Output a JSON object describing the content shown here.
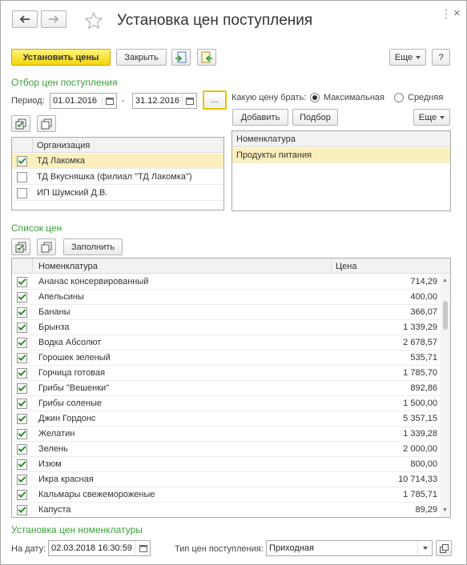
{
  "window": {
    "title": "Установка цен поступления",
    "more_label": "Еще",
    "help_label": "?",
    "close_glyph": "×",
    "menu_glyph": "⋮"
  },
  "toolbar": {
    "set_prices_label": "Установить цены",
    "close_label": "Закрыть"
  },
  "filter": {
    "section_title": "Отбор цен поступления",
    "period_label": "Период:",
    "date_from": "01.01.2016",
    "dash": "-",
    "date_to": "31.12.2016",
    "period_choose_label": "...",
    "price_kind_label": "Какую цену брать:",
    "option_max": "Максимальная",
    "option_avg": "Средняя",
    "selected_option": "max",
    "add_label": "Добавить",
    "pick_label": "Подбор",
    "more_label": "Еще"
  },
  "org_table": {
    "header": "Организация",
    "rows": [
      {
        "name": "ТД Лакомка",
        "checked": true,
        "selected": true
      },
      {
        "name": "ТД Вкусняшка (филиал \"ТД Лакомка\")",
        "checked": false,
        "selected": false
      },
      {
        "name": "ИП Шумский Д.В.",
        "checked": false,
        "selected": false
      }
    ]
  },
  "nom_table": {
    "header": "Номенклатура",
    "rows": [
      {
        "name": "Продукты питания",
        "selected": true
      }
    ]
  },
  "prices": {
    "section_title": "Список цен",
    "fill_label": "Заполнить",
    "col_nomenclature": "Номенклатура",
    "col_price": "Цена",
    "rows": [
      {
        "name": "Ананас консервированный",
        "price": "714,29",
        "checked": true
      },
      {
        "name": "Апельсины",
        "price": "400,00",
        "checked": true
      },
      {
        "name": "Бананы",
        "price": "366,07",
        "checked": true
      },
      {
        "name": "Брынза",
        "price": "1 339,29",
        "checked": true
      },
      {
        "name": "Водка Абсолют",
        "price": "2 678,57",
        "checked": true
      },
      {
        "name": "Горошек зеленый",
        "price": "535,71",
        "checked": true
      },
      {
        "name": "Горчица готовая",
        "price": "1 785,70",
        "checked": true
      },
      {
        "name": "Грибы \"Вешенки\"",
        "price": "892,86",
        "checked": true
      },
      {
        "name": "Грибы соленые",
        "price": "1 500,00",
        "checked": true
      },
      {
        "name": "Джин Гордонс",
        "price": "5 357,15",
        "checked": true
      },
      {
        "name": "Желатин",
        "price": "1 339,28",
        "checked": true
      },
      {
        "name": "Зелень",
        "price": "2 000,00",
        "checked": true
      },
      {
        "name": "Изюм",
        "price": "800,00",
        "checked": true
      },
      {
        "name": "Икра красная",
        "price": "10 714,33",
        "checked": true
      },
      {
        "name": "Кальмары свежемороженые",
        "price": "1 785,71",
        "checked": true
      },
      {
        "name": "Капуста",
        "price": "89,29",
        "checked": true
      }
    ]
  },
  "settings": {
    "section_title": "Установка цен номенклатуры",
    "date_label": "На дату:",
    "date_value": "02.03.2018 16:30:59",
    "price_type_label": "Тип цен поступления:",
    "price_type_value": "Приходная"
  },
  "colors": {
    "accent_green": "#3a9f3a",
    "primary_button": "#f4d60c",
    "selected_row": "#fbf0bd"
  }
}
